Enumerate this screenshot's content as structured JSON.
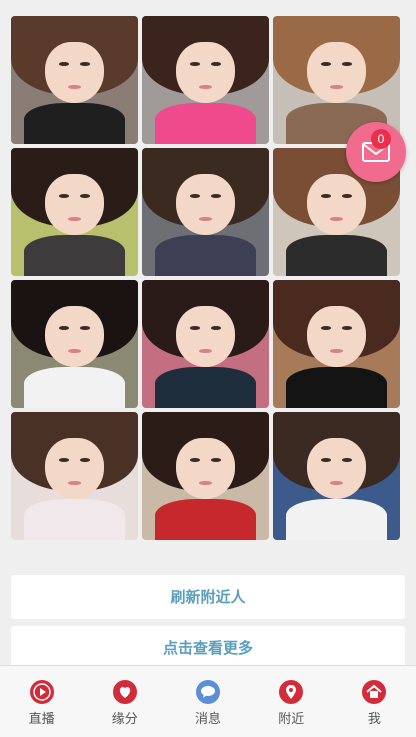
{
  "photos": [
    {
      "hair": "#5a3a2a",
      "bg": "#8a7d76",
      "body": "#1f1f1f"
    },
    {
      "hair": "#3b241b",
      "bg": "#a09b98",
      "body": "#ef4b8c"
    },
    {
      "hair": "#9a6a47",
      "bg": "#c5bfb7",
      "body": "#8a6a55"
    },
    {
      "hair": "#2a1c16",
      "bg": "#b8c06e",
      "body": "#3d3b3b"
    },
    {
      "hair": "#3a2a20",
      "bg": "#6e6f74",
      "body": "#3d3f55"
    },
    {
      "hair": "#7a4e35",
      "bg": "#cfc6bb",
      "body": "#2c2c2c"
    },
    {
      "hair": "#1a1312",
      "bg": "#8b8874",
      "body": "#f2f2f2"
    },
    {
      "hair": "#2a1a18",
      "bg": "#c46f81",
      "body": "#1e2e3c"
    },
    {
      "hair": "#4a2a1e",
      "bg": "#a77a5a",
      "body": "#141414"
    },
    {
      "hair": "#4a3125",
      "bg": "#e7dedb",
      "body": "#f0e8ea"
    },
    {
      "hair": "#2b1c18",
      "bg": "#c9b9a6",
      "body": "#c6282d"
    },
    {
      "hair": "#3b2a22",
      "bg": "#3c5b8c",
      "body": "#f2f2f2"
    }
  ],
  "mail": {
    "badge": "0",
    "icon": "mail-icon",
    "color": "#f06b8d"
  },
  "actions": {
    "refresh": "刷新附近人",
    "more": "点击查看更多"
  },
  "tabs": [
    {
      "label": "直播",
      "icon": "play-icon"
    },
    {
      "label": "缘分",
      "icon": "heart-icon"
    },
    {
      "label": "消息",
      "icon": "chat-icon"
    },
    {
      "label": "附近",
      "icon": "location-pin-icon"
    },
    {
      "label": "我",
      "icon": "home-icon"
    }
  ],
  "accent": "#5c9fbd",
  "tab_icon_color": "#d22b3a"
}
